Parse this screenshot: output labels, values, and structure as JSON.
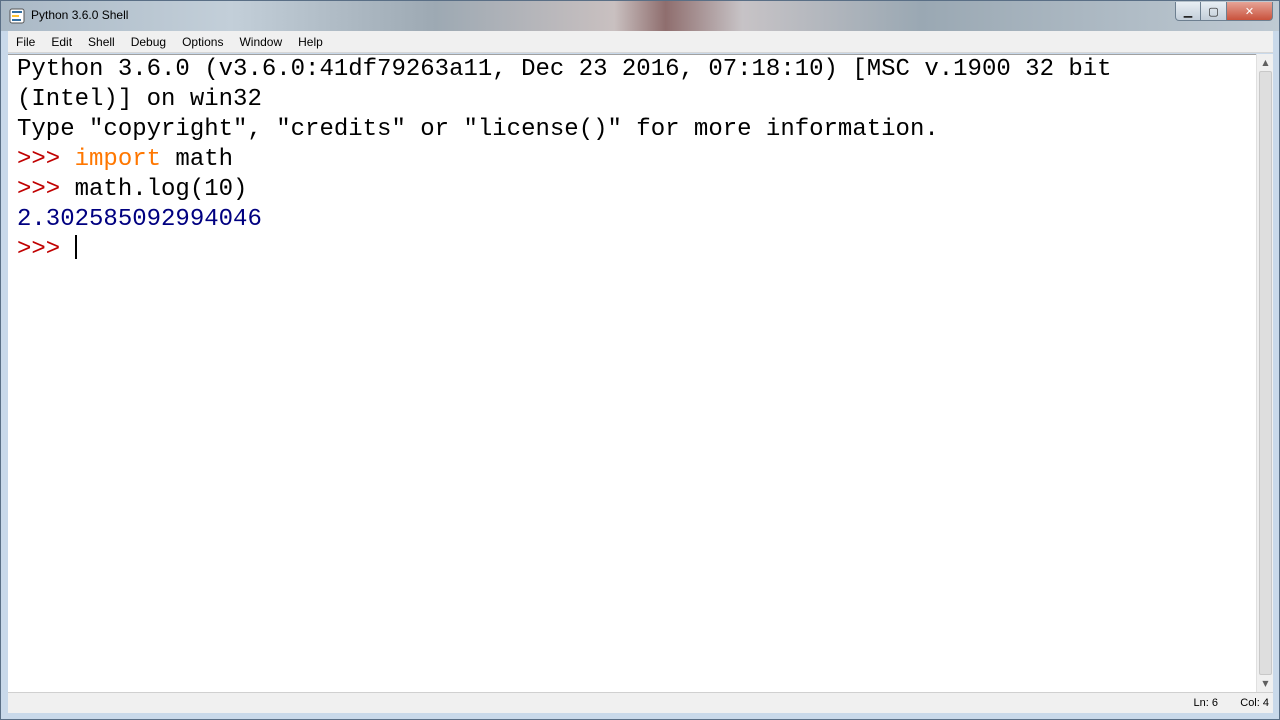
{
  "window": {
    "title": "Python 3.6.0 Shell"
  },
  "menu": [
    "File",
    "Edit",
    "Shell",
    "Debug",
    "Options",
    "Window",
    "Help"
  ],
  "shell": {
    "banner_line1": "Python 3.6.0 (v3.6.0:41df79263a11, Dec 23 2016, 07:18:10) [MSC v.1900 32 bit",
    "banner_line2": "(Intel)] on win32",
    "banner_line3": "Type \"copyright\", \"credits\" or \"license()\" for more information.",
    "prompt": ">>> ",
    "cmd1_keyword": "import",
    "cmd1_rest": " math",
    "cmd2": "math.log(10)",
    "output": "2.302585092994046"
  },
  "status": {
    "line": "Ln: 6",
    "col": "Col: 4"
  },
  "colors": {
    "prompt": "#c00000",
    "keyword": "#ff7700",
    "output": "#000080"
  }
}
